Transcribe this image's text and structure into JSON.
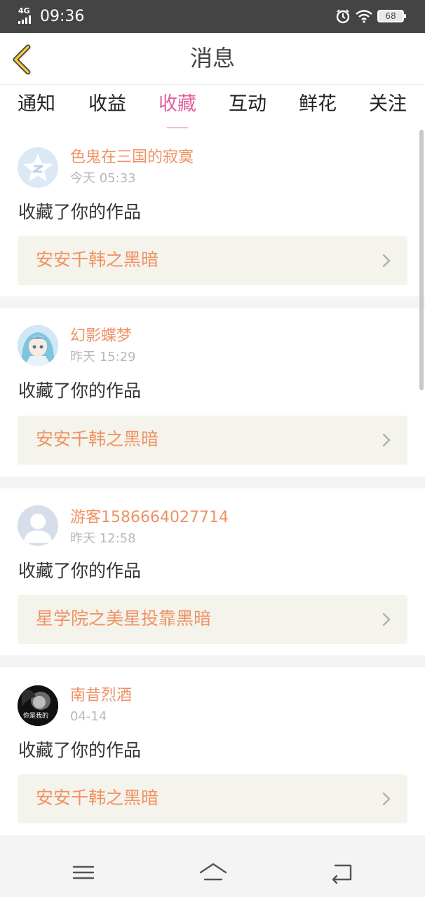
{
  "status_bar": {
    "network": "4G",
    "time": "09:36",
    "battery": "68",
    "icons": [
      "signal-icon",
      "alarm-icon",
      "wifi-icon",
      "battery-icon"
    ]
  },
  "header": {
    "title": "消息",
    "back_icon": "chevron-left-icon"
  },
  "tabs": [
    {
      "label": "通知",
      "active": false
    },
    {
      "label": "收益",
      "active": false
    },
    {
      "label": "收藏",
      "active": true
    },
    {
      "label": "互动",
      "active": false
    },
    {
      "label": "鲜花",
      "active": false
    },
    {
      "label": "关注",
      "active": false
    }
  ],
  "messages": [
    {
      "user": "色鬼在三国的寂寞",
      "time": "今天 05:33",
      "action": "收藏了你的作品",
      "work": "安安千韩之黑暗",
      "avatar": "qq-star-avatar"
    },
    {
      "user": "幻影蝶梦",
      "time": "昨天 15:29",
      "action": "收藏了你的作品",
      "work": "安安千韩之黑暗",
      "avatar": "anime-girl-avatar"
    },
    {
      "user": "游客1586664027714",
      "time": "昨天 12:58",
      "action": "收藏了你的作品",
      "work": "星学院之美星投靠黑暗",
      "avatar": "default-person-avatar"
    },
    {
      "user": "南昔烈酒",
      "time": "04-14",
      "action": "收藏了你的作品",
      "work": "安安千韩之黑暗",
      "avatar": "dark-photo-avatar",
      "avatar_caption": "你是我的"
    }
  ],
  "navbar": {
    "icons": [
      "menu-icon",
      "home-icon",
      "back-icon"
    ]
  },
  "colors": {
    "accent_pink": "#e2609c",
    "name_orange": "#ef9264",
    "card_bg": "#f5f4ec",
    "status_bar_bg": "#444444"
  }
}
